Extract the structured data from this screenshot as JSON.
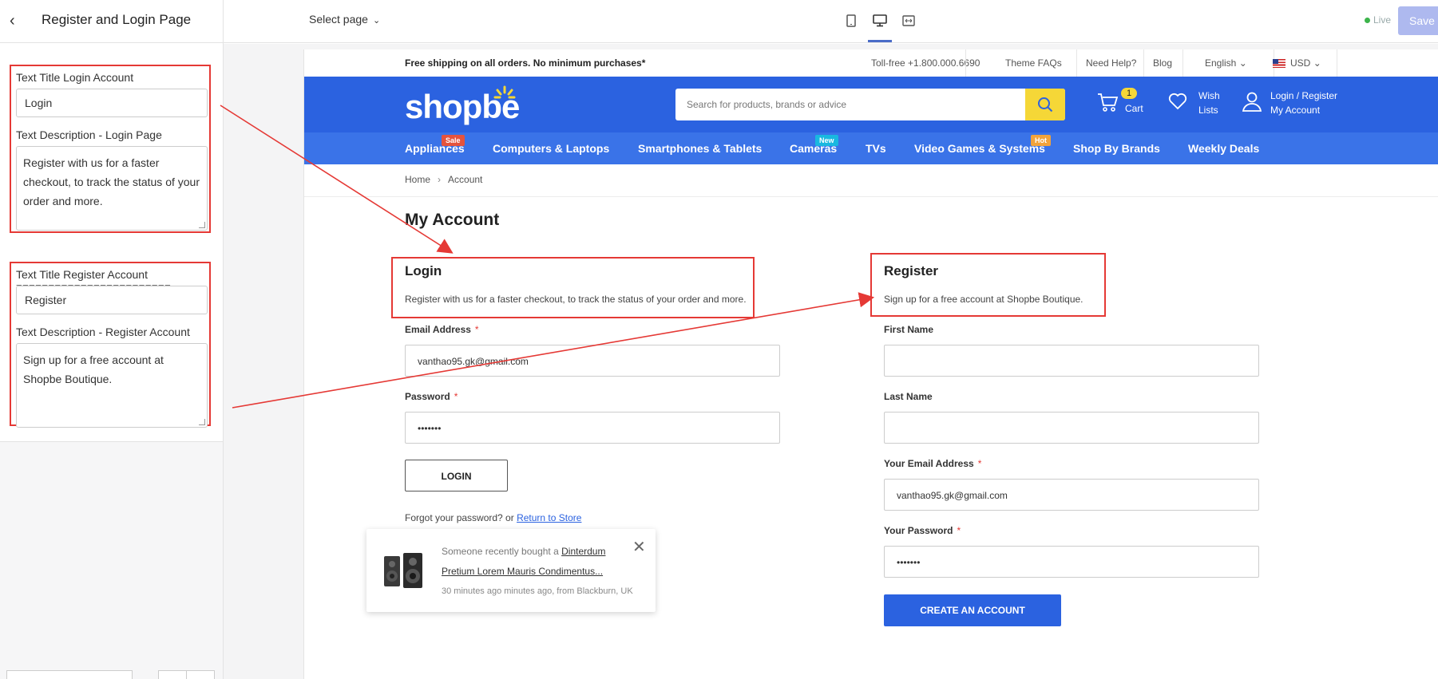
{
  "editor": {
    "title": "Register and Login Page",
    "select_page": "Select page",
    "live_label": "Live",
    "save_label": "Save"
  },
  "left_panel": {
    "login_title_label": "Text Title Login Account",
    "login_title_value": "Login",
    "login_desc_label": "Text Description - Login Page",
    "login_desc_value": "Register with us for a faster checkout, to track the status of your order and more.",
    "separator": "========================",
    "register_title_label": "Text Title Register Account",
    "register_title_value": "Register",
    "register_desc_label": "Text Description - Register Account",
    "register_desc_value": "Sign up for a free account at Shopbe Boutique."
  },
  "store": {
    "announcement": "Free shipping on all orders. No minimum purchases*",
    "tollfree": "Toll-free +1.800.000.6690",
    "theme_faqs": "Theme FAQs",
    "need_help": "Need Help?",
    "blog": "Blog",
    "language": "English",
    "currency": "USD",
    "logo": "shopbe",
    "search_placeholder": "Search for products, brands or advice",
    "cart_count": "1",
    "cart_label": "Cart",
    "wish_line1": "Wish",
    "wish_line2": "Lists",
    "account_line1": "Login / Register",
    "account_line2": "My Account",
    "nav": [
      {
        "label": "Appliances",
        "badge": "Sale",
        "badge_color": "#e5533d"
      },
      {
        "label": "Computers & Laptops"
      },
      {
        "label": "Smartphones & Tablets"
      },
      {
        "label": "Cameras",
        "badge": "New",
        "badge_color": "#19b8e0"
      },
      {
        "label": "TVs"
      },
      {
        "label": "Video Games & Systems",
        "badge": "Hot",
        "badge_color": "#f2a33b"
      },
      {
        "label": "Shop By Brands"
      },
      {
        "label": "Weekly Deals"
      }
    ],
    "breadcrumb_home": "Home",
    "breadcrumb_current": "Account",
    "page_title": "My Account"
  },
  "login": {
    "title": "Login",
    "description": "Register with us for a faster checkout, to track the status of your order and more.",
    "email_label": "Email Address",
    "email_value": "vanthao95.gk@gmail.com",
    "password_label": "Password",
    "password_value": "•••••••",
    "button": "LOGIN",
    "forgot_text": "Forgot your password? or",
    "return_link": "Return to Store"
  },
  "register": {
    "title": "Register",
    "description": "Sign up for a free account at Shopbe Boutique.",
    "first_name_label": "First Name",
    "last_name_label": "Last Name",
    "email_label": "Your Email Address",
    "email_value": "vanthao95.gk@gmail.com",
    "password_label": "Your Password",
    "password_value": "•••••••",
    "button": "CREATE AN ACCOUNT"
  },
  "popup": {
    "prefix": "Someone recently bought a",
    "product": "Dinterdum Pretium Lorem Mauris Condimentus...",
    "time": "30 minutes ago minutes ago, from Blackburn, UK"
  },
  "colors": {
    "brand_blue": "#2b62e0",
    "nav_blue": "#3a73e8",
    "accent_yellow": "#f5d737",
    "annotation_red": "#e53935"
  }
}
